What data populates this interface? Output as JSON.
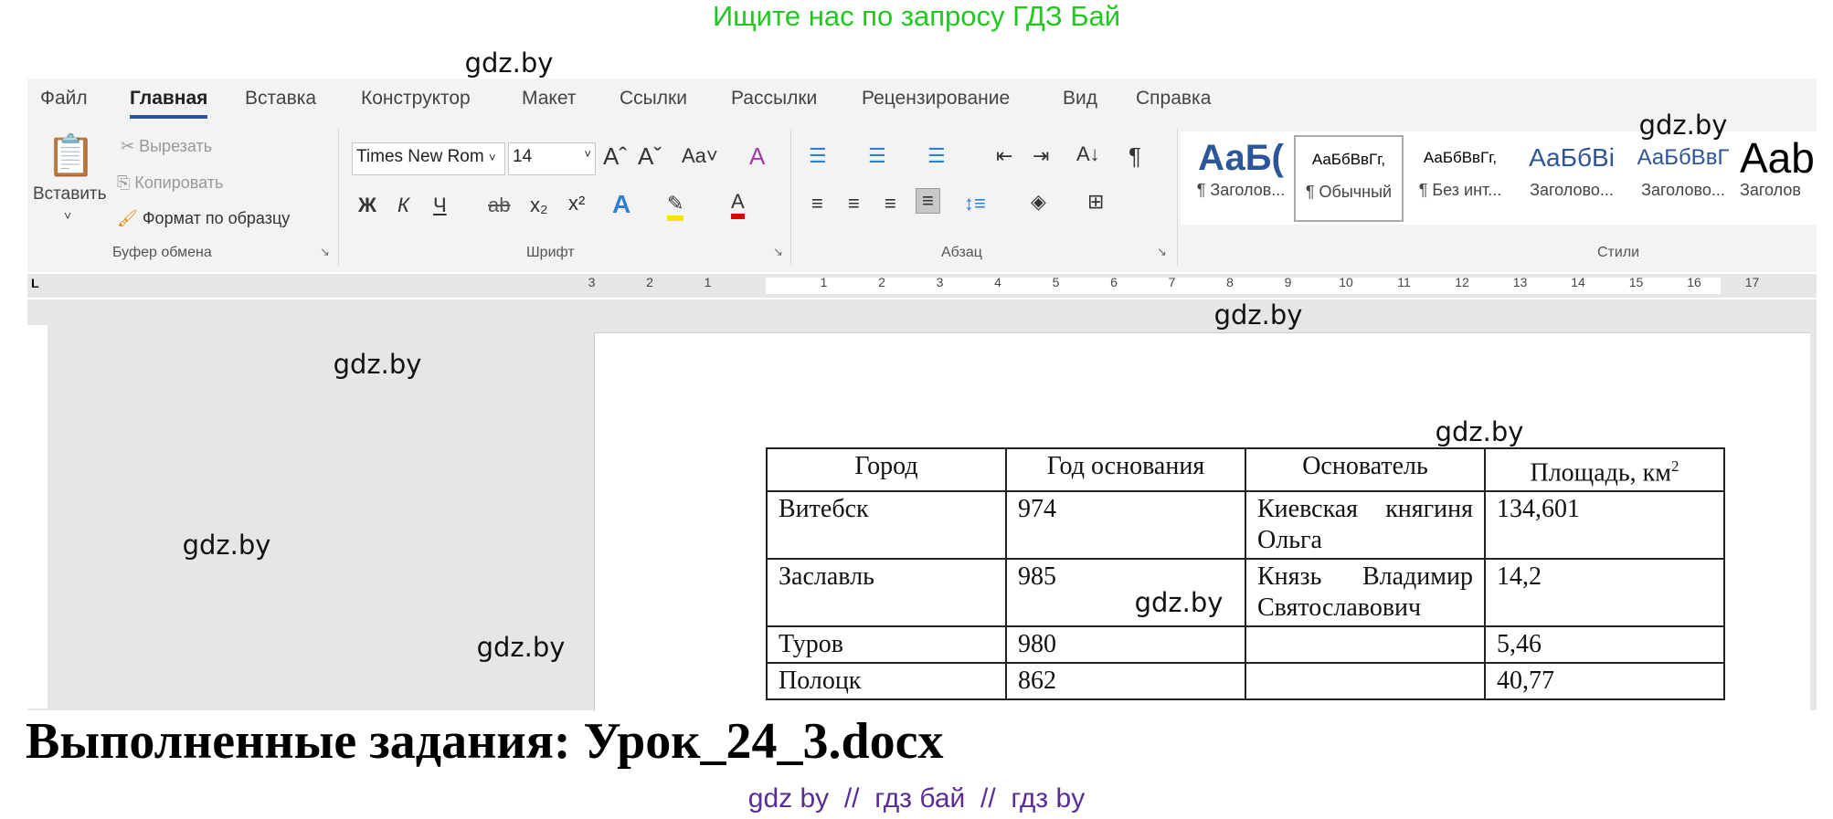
{
  "banner": "Ищите нас по запросу ГДЗ Бай",
  "watermark": "gdz.by",
  "ribbon": {
    "tabs": [
      "Файл",
      "Главная",
      "Вставка",
      "Конструктор",
      "Макет",
      "Ссылки",
      "Рассылки",
      "Рецензирование",
      "Вид",
      "Справка"
    ],
    "active_tab": "Главная",
    "clipboard": {
      "paste": "Вставить",
      "cut": "Вырезать",
      "copy": "Копировать",
      "format_painter": "Формат по образцу",
      "label": "Буфер обмена"
    },
    "font": {
      "name": "Times New Rom",
      "size": "14",
      "label": "Шрифт",
      "bold": "Ж",
      "italic": "К",
      "underline": "Ч",
      "case": "Aa"
    },
    "paragraph": {
      "label": "Абзац"
    },
    "styles": {
      "label": "Стили",
      "items": [
        {
          "preview": "АаБ(",
          "name": "¶ Заголов..."
        },
        {
          "preview": "АаБбВвГг,",
          "name": "¶ Обычный"
        },
        {
          "preview": "АаБбВвГг,",
          "name": "¶ Без инт..."
        },
        {
          "preview": "АаБбВі",
          "name": "Заголово..."
        },
        {
          "preview": "АаБбВвГ",
          "name": "Заголово..."
        },
        {
          "preview": "Aab",
          "name": "Заголов"
        }
      ]
    }
  },
  "ruler": [
    "3",
    "2",
    "1",
    "1",
    "2",
    "3",
    "4",
    "5",
    "6",
    "7",
    "8",
    "9",
    "10",
    "11",
    "12",
    "13",
    "14",
    "15",
    "16",
    "17"
  ],
  "table": {
    "headers": [
      "Город",
      "Год основания",
      "Основатель",
      "Площадь, км"
    ],
    "header_sup": "2",
    "rows": [
      [
        "Витебск",
        "974",
        "Киевская княгиня Ольга",
        "134,601"
      ],
      [
        "Заславль",
        "985",
        "Князь Владимир Святославович",
        "14,2"
      ],
      [
        "Туров",
        "980",
        "",
        "5,46"
      ],
      [
        "Полоцк",
        "862",
        "",
        "40,77"
      ]
    ]
  },
  "title": "Выполненные задания: Урок_24_3.docx",
  "footer": "gdz by  //  гдз бай  //  гдз by",
  "colors": {
    "banner": "#21c821",
    "accent": "#2b579a",
    "footer": "#5a2d96"
  }
}
